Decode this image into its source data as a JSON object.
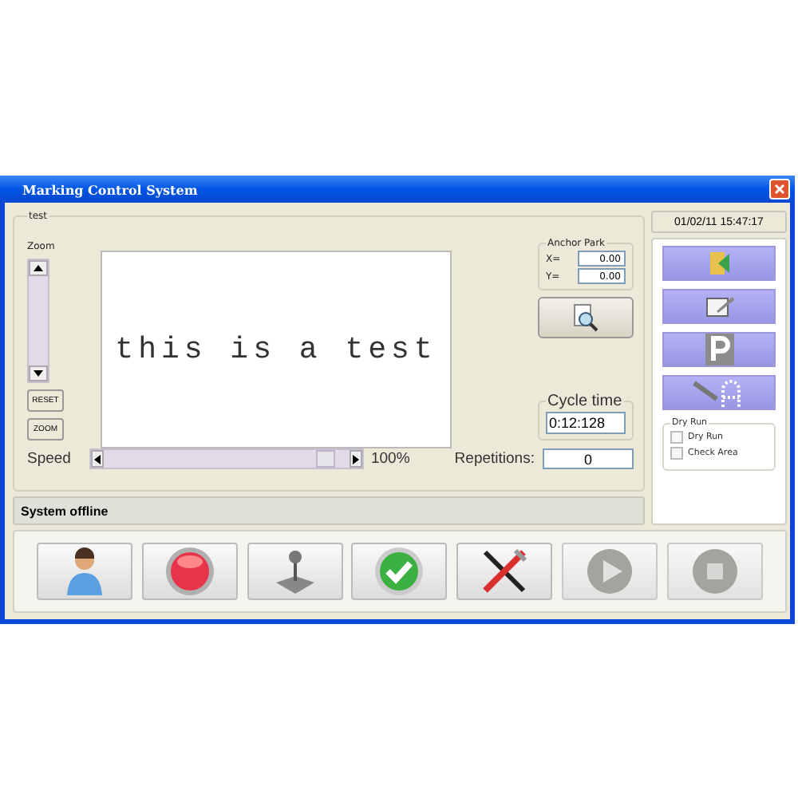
{
  "window": {
    "title": "Marking Control System"
  },
  "group": {
    "label": "test"
  },
  "zoom": {
    "label": "Zoom",
    "buttons": [
      "RESET",
      "ZOOM"
    ]
  },
  "preview": {
    "text": "this is a test"
  },
  "anchor_park": {
    "title": "Anchor Park",
    "fields": [
      {
        "label": "X=",
        "value": "0.00"
      },
      {
        "label": "Y=",
        "value": "0.00"
      }
    ]
  },
  "cycle_time": {
    "title": "Cycle time",
    "value": "0:12:128"
  },
  "speed": {
    "label": "Speed",
    "level": 0.93,
    "reading": "100%"
  },
  "repetitions": {
    "label": "Repetitions:",
    "value": "0"
  },
  "status": "System offline",
  "datetime": "01/02/11 15:47:17",
  "side_buttons": [
    {
      "kind": "folder"
    },
    {
      "kind": "edit"
    },
    {
      "kind": "park"
    },
    {
      "kind": "trace"
    }
  ],
  "dry_run": {
    "title": "Dry Run",
    "options": [
      {
        "label": "Dry Run",
        "checked": false
      },
      {
        "label": "Check Area",
        "checked": false
      }
    ]
  },
  "toolbar": [
    {
      "kind": "user",
      "disabled": false
    },
    {
      "kind": "stop",
      "disabled": false
    },
    {
      "kind": "joystick",
      "disabled": false
    },
    {
      "kind": "check",
      "disabled": false
    },
    {
      "kind": "tools",
      "disabled": false
    },
    {
      "kind": "play",
      "disabled": true
    },
    {
      "kind": "halt",
      "disabled": true
    }
  ]
}
